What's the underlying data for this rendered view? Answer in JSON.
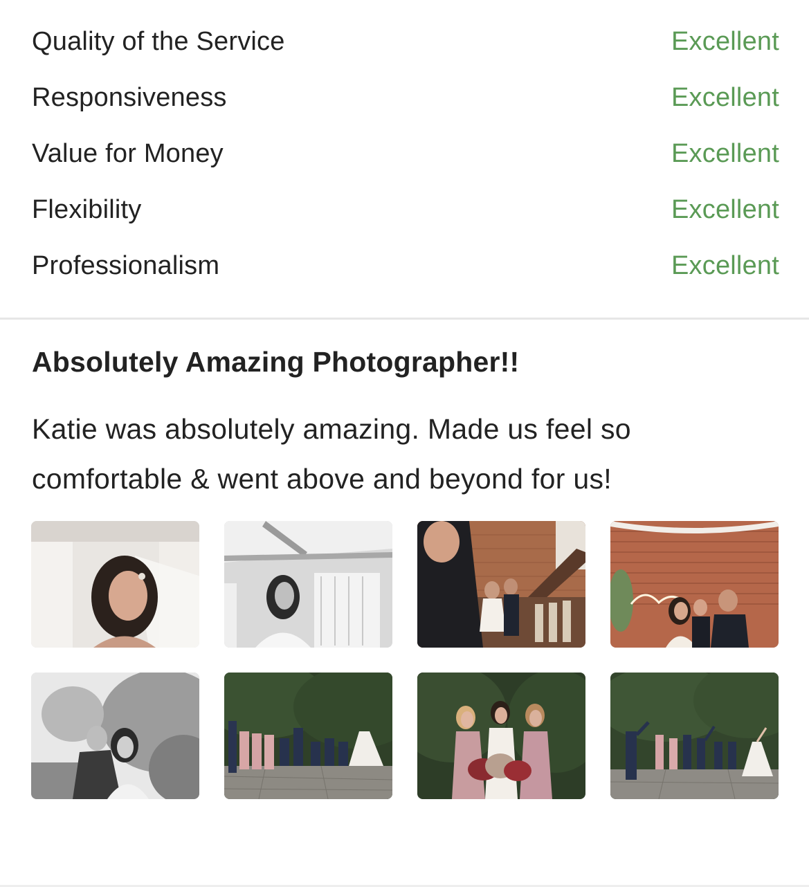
{
  "ratings": [
    {
      "label": "Quality of the Service",
      "value": "Excellent"
    },
    {
      "label": "Responsiveness",
      "value": "Excellent"
    },
    {
      "label": "Value for Money",
      "value": "Excellent"
    },
    {
      "label": "Flexibility",
      "value": "Excellent"
    },
    {
      "label": "Professionalism",
      "value": "Excellent"
    }
  ],
  "review": {
    "title": "Absolutely Amazing Photographer!!",
    "body_line1": "Katie was absolutely amazing. Made us feel so",
    "body_line2": "comfortable & went above and beyond for us!"
  },
  "photos": [
    {
      "name": "photo-bride-portrait-veil"
    },
    {
      "name": "photo-bride-bw-window"
    },
    {
      "name": "photo-aisle-walk"
    },
    {
      "name": "photo-couple-neon-sign"
    },
    {
      "name": "photo-couple-bw-trees"
    },
    {
      "name": "photo-wedding-party-garden"
    },
    {
      "name": "photo-bride-bridesmaids"
    },
    {
      "name": "photo-wedding-party-jumping"
    }
  ],
  "colors": {
    "rating_value": "#5a9a55",
    "text": "#222222",
    "divider": "#e6e6e6"
  }
}
